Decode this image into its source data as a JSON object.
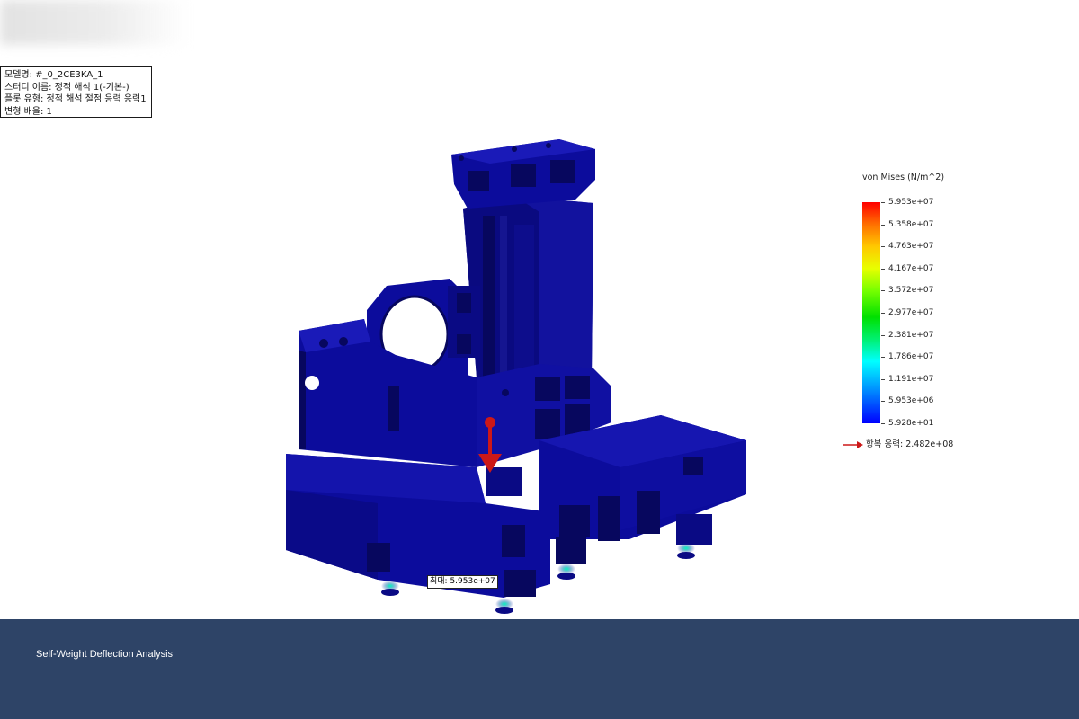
{
  "info_box": {
    "model_name": "모델명: #_0_2CE3KA_1",
    "study_name": "스터디 이름: 정적 해석 1(-기본-)",
    "plot_type": "플롯 유형: 정적 해석 절점 응력 응력1",
    "deformation_scale": "변형 배율: 1"
  },
  "legend": {
    "title": "von Mises (N/m^2)",
    "labels": [
      "5.953e+07",
      "5.358e+07",
      "4.763e+07",
      "4.167e+07",
      "3.572e+07",
      "2.977e+07",
      "2.381e+07",
      "1.786e+07",
      "1.191e+07",
      "5.953e+06",
      "5.928e+01"
    ],
    "colorbar_top": "#ff0000",
    "colorbar_bottom": "#0000ff"
  },
  "yield_strength": "항복 응력: 2.482e+08",
  "max_marker": "최대: 5.953e+07",
  "colors": {
    "model": "#0c0c9c",
    "model_dark": "#07075e",
    "model_light": "#1a1ab8",
    "footer": "#2e4467",
    "arrow": "#cc1818"
  },
  "footer": {
    "caption": "Self-Weight Deflection Analysis"
  }
}
